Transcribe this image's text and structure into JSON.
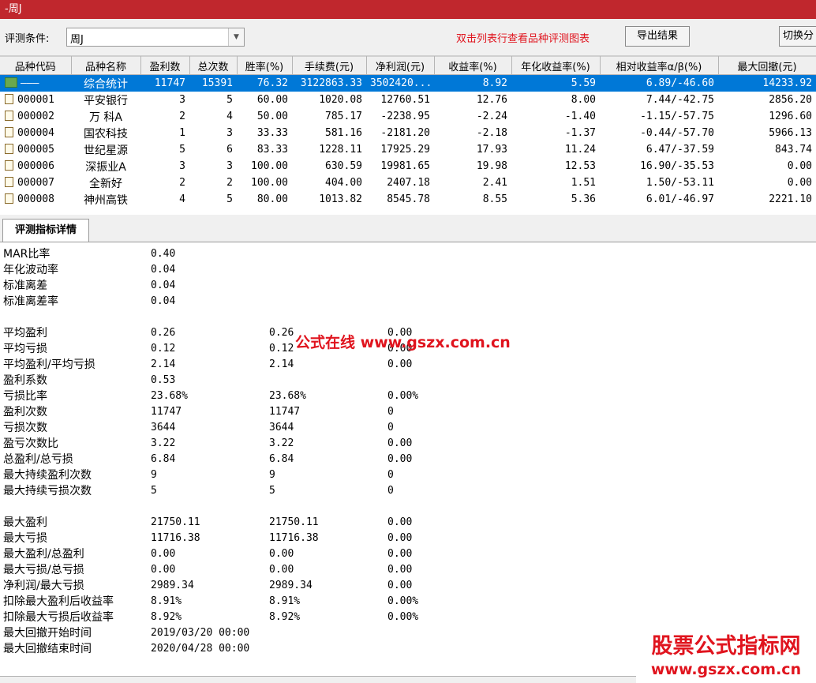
{
  "window": {
    "title": "-周J"
  },
  "toolbar": {
    "condition_label": "评测条件:",
    "condition_value": "周J",
    "hint": "双击列表行查看品种评测图表",
    "export_label": "导出结果",
    "switch_label": "切换分"
  },
  "grid": {
    "columns": [
      "品种代码",
      "品种名称",
      "盈利数",
      "总次数",
      "胜率(%)",
      "手续费(元)",
      "净利润(元)",
      "收益率(%)",
      "年化收益率(%)",
      "相对收益率α/β(%)",
      "最大回撤(元)"
    ],
    "rows": [
      [
        "———",
        "综合统计",
        "11747",
        "15391",
        "76.32",
        "3122863.33",
        "3502420...",
        "8.92",
        "5.59",
        "6.89/-46.60",
        "14233.92"
      ],
      [
        "000001",
        "平安银行",
        "3",
        "5",
        "60.00",
        "1020.08",
        "12760.51",
        "12.76",
        "8.00",
        "7.44/-42.75",
        "2856.20"
      ],
      [
        "000002",
        "万 科A",
        "2",
        "4",
        "50.00",
        "785.17",
        "-2238.95",
        "-2.24",
        "-1.40",
        "-1.15/-57.75",
        "1296.60"
      ],
      [
        "000004",
        "国农科技",
        "1",
        "3",
        "33.33",
        "581.16",
        "-2181.20",
        "-2.18",
        "-1.37",
        "-0.44/-57.70",
        "5966.13"
      ],
      [
        "000005",
        "世纪星源",
        "5",
        "6",
        "83.33",
        "1228.11",
        "17925.29",
        "17.93",
        "11.24",
        "6.47/-37.59",
        "843.74"
      ],
      [
        "000006",
        "深振业A",
        "3",
        "3",
        "100.00",
        "630.59",
        "19981.65",
        "19.98",
        "12.53",
        "16.90/-35.53",
        "0.00"
      ],
      [
        "000007",
        "全新好",
        "2",
        "2",
        "100.00",
        "404.00",
        "2407.18",
        "2.41",
        "1.51",
        "1.50/-53.11",
        "0.00"
      ],
      [
        "000008",
        "神州高铁",
        "4",
        "5",
        "80.00",
        "1013.82",
        "8545.78",
        "8.55",
        "5.36",
        "6.01/-46.97",
        "2221.10"
      ]
    ]
  },
  "tab": {
    "label": "评测指标详情"
  },
  "details": [
    {
      "k": "MAR比率",
      "v1": "0.40",
      "v2": "",
      "v3": ""
    },
    {
      "k": "年化波动率",
      "v1": "0.04",
      "v2": "",
      "v3": ""
    },
    {
      "k": "标准离差",
      "v1": "0.04",
      "v2": "",
      "v3": ""
    },
    {
      "k": "标准离差率",
      "v1": "0.04",
      "v2": "",
      "v3": ""
    },
    {
      "k": "平均盈利",
      "v1": "0.26",
      "v2": "0.26",
      "v3": "0.00"
    },
    {
      "k": "平均亏损",
      "v1": "0.12",
      "v2": "0.12",
      "v3": "0.00"
    },
    {
      "k": "平均盈利/平均亏损",
      "v1": "2.14",
      "v2": "2.14",
      "v3": "0.00"
    },
    {
      "k": "盈利系数",
      "v1": "0.53",
      "v2": "",
      "v3": ""
    },
    {
      "k": "亏损比率",
      "v1": "23.68%",
      "v2": "23.68%",
      "v3": "0.00%"
    },
    {
      "k": "盈利次数",
      "v1": "11747",
      "v2": "11747",
      "v3": "0"
    },
    {
      "k": "亏损次数",
      "v1": "3644",
      "v2": "3644",
      "v3": "0"
    },
    {
      "k": "盈亏次数比",
      "v1": "3.22",
      "v2": "3.22",
      "v3": "0.00"
    },
    {
      "k": "总盈利/总亏损",
      "v1": "6.84",
      "v2": "6.84",
      "v3": "0.00"
    },
    {
      "k": "最大持续盈利次数",
      "v1": "9",
      "v2": "9",
      "v3": "0"
    },
    {
      "k": "最大持续亏损次数",
      "v1": "5",
      "v2": "5",
      "v3": "0"
    },
    {
      "k": "最大盈利",
      "v1": "21750.11",
      "v2": "21750.11",
      "v3": "0.00"
    },
    {
      "k": "最大亏损",
      "v1": "11716.38",
      "v2": "11716.38",
      "v3": "0.00"
    },
    {
      "k": "最大盈利/总盈利",
      "v1": "0.00",
      "v2": "0.00",
      "v3": "0.00"
    },
    {
      "k": "最大亏损/总亏损",
      "v1": "0.00",
      "v2": "0.00",
      "v3": "0.00"
    },
    {
      "k": "净利润/最大亏损",
      "v1": "2989.34",
      "v2": "2989.34",
      "v3": "0.00"
    },
    {
      "k": "扣除最大盈利后收益率",
      "v1": "8.91%",
      "v2": "8.91%",
      "v3": "0.00%"
    },
    {
      "k": "扣除最大亏损后收益率",
      "v1": "8.92%",
      "v2": "8.92%",
      "v3": "0.00%"
    },
    {
      "k": "最大回撤开始时间",
      "v1": "2019/03/20 00:00",
      "v2": "",
      "v3": ""
    },
    {
      "k": "最大回撤结束时间",
      "v1": "2020/04/28 00:00",
      "v2": "",
      "v3": ""
    }
  ],
  "watermarks": {
    "center": "公式在线 www.gszx.com.cn",
    "corner_line1": "股票公式指标网",
    "corner_line2": "www.gszx.com.cn"
  },
  "colors": {
    "titlebar": "#c0272d",
    "selected_row": "#0078d7",
    "hint": "#e0141e"
  }
}
